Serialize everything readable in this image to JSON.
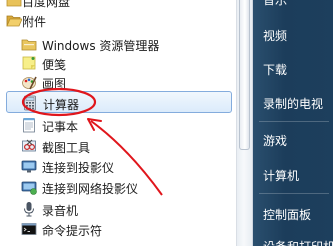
{
  "left_list": {
    "top_partial": "百度网盘",
    "folder": "附件",
    "items": [
      {
        "label": "Windows 资源管理器",
        "icon": "explorer-folder-icon"
      },
      {
        "label": "便笺",
        "icon": "sticky-notes-icon"
      },
      {
        "label": "画图",
        "icon": "paint-icon"
      },
      {
        "label": "计算器",
        "icon": "calculator-icon",
        "selected": true
      },
      {
        "label": "记事本",
        "icon": "notepad-icon"
      },
      {
        "label": "截图工具",
        "icon": "snipping-tool-icon"
      },
      {
        "label": "连接到投影仪",
        "icon": "projector-icon"
      },
      {
        "label": "连接到网络投影仪",
        "icon": "network-projector-icon"
      },
      {
        "label": "录音机",
        "icon": "microphone-icon"
      },
      {
        "label": "命令提示符",
        "icon": "command-prompt-icon"
      }
    ]
  },
  "right_pane": {
    "items": [
      "音乐",
      "视频",
      "下载",
      "录制的电视",
      "游戏",
      "计算机",
      "控制面板",
      "设备和打印机"
    ]
  },
  "colors": {
    "annotation": "#e0161c",
    "right_pane_bg": "#1d3f5d",
    "selection_border": "#84acdd"
  }
}
